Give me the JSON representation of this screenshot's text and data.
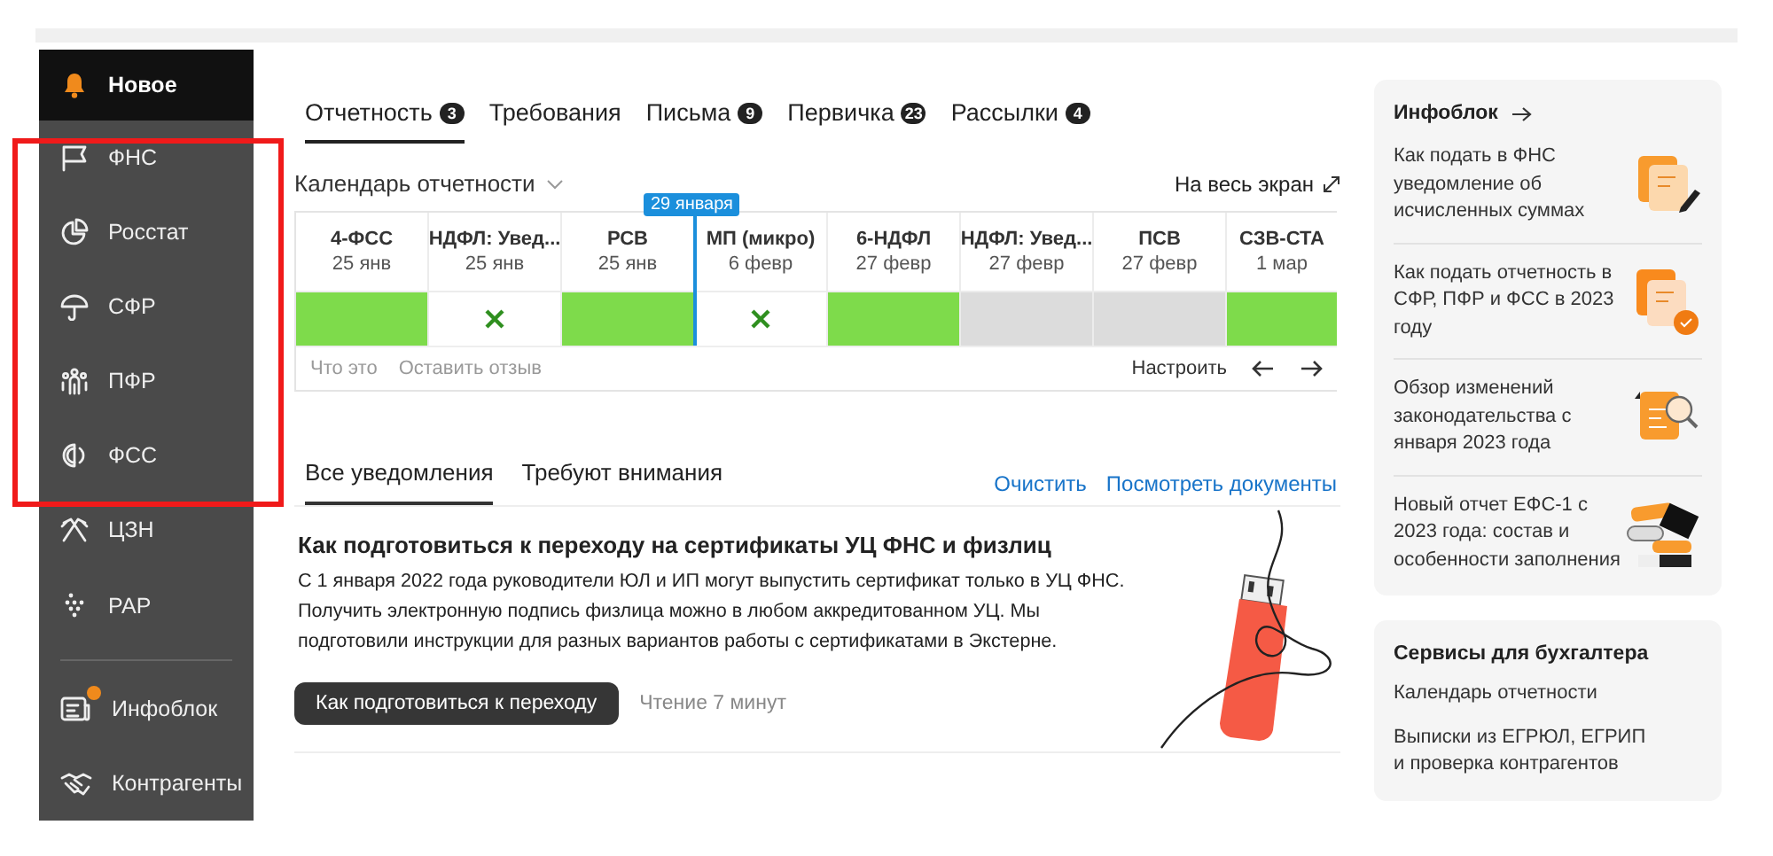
{
  "sidebar": {
    "items": [
      {
        "label": "Новое",
        "selected": true
      },
      {
        "label": "ФНС",
        "selected": false
      },
      {
        "label": "Росстат",
        "selected": false
      },
      {
        "label": "СФР",
        "selected": false
      },
      {
        "label": "ПФР",
        "selected": false
      },
      {
        "label": "ФСС",
        "selected": false
      },
      {
        "label": "ЦЗН",
        "selected": false
      },
      {
        "label": "РАР",
        "selected": false
      }
    ],
    "bottom_items": [
      {
        "label": "Инфоблок",
        "selected": false,
        "badge": true
      },
      {
        "label": "Контрагенты",
        "selected": false,
        "badge": false
      }
    ]
  },
  "tabs": [
    {
      "label": "Отчетность",
      "count": "3",
      "selected": true
    },
    {
      "label": "Требования",
      "selected": false
    },
    {
      "label": "Письма",
      "count": "9",
      "selected": false
    },
    {
      "label": "Первичка",
      "count": "23",
      "selected": false
    },
    {
      "label": "Рассылки",
      "count": "4",
      "selected": false
    }
  ],
  "calendar": {
    "title": "Календарь отчетности",
    "fullscreen": "На весь экран",
    "today": "29 января",
    "columns": [
      {
        "name": "4-ФСС",
        "date": "25 янв",
        "kind": "done",
        "current": false
      },
      {
        "name": "НДФЛ: Увед...",
        "date": "25 янв",
        "kind": "missed",
        "current": false
      },
      {
        "name": "РСВ",
        "date": "25 янв",
        "kind": "done",
        "current": false
      },
      {
        "name": "МП (микро)",
        "date": "6 февр",
        "kind": "missed",
        "current": true
      },
      {
        "name": "6-НДФЛ",
        "date": "27 февр",
        "kind": "done",
        "current": false
      },
      {
        "name": "НДФЛ: Увед...",
        "date": "27 февр",
        "kind": "empty",
        "current": false
      },
      {
        "name": "ПСВ",
        "date": "27 февр",
        "kind": "empty",
        "current": false
      },
      {
        "name": "СЗВ-СТА",
        "date": "1 мар",
        "kind": "done",
        "current": false
      }
    ],
    "footer_links": [
      "Что это",
      "Оставить отзыв"
    ],
    "configure": "Настроить"
  },
  "notices": {
    "tabs": [
      {
        "label": "Все уведомления",
        "selected": true
      },
      {
        "label": "Требуют внимания",
        "selected": false
      }
    ],
    "actions": [
      "Очистить",
      "Посмотреть документы"
    ],
    "article": {
      "title": "Как подготовиться к переходу на сертификаты УЦ ФНС и физлиц",
      "text": "С 1 января 2022 года руководители ЮЛ и ИП могут выпустить сертификат только в УЦ ФНС. Получить электронную подпись физлица можно в любом аккредитованном УЦ. Мы подготовили инструкции для разных вариантов работы с сертификатами в Экстерне.",
      "button": "Как подготовиться к переходу",
      "read_time": "Чтение 7 минут"
    }
  },
  "infoblock": {
    "title": "Инфоблок",
    "items": [
      {
        "text": "Как подать в ФНС уведомление об исчисленных суммах"
      },
      {
        "text": "Как подать отчетность в СФР, ПФР и ФСС в 2023 году"
      },
      {
        "text": "Обзор изменений законодательства с января 2023 года"
      },
      {
        "text": "Новый отчет ЕФС-1 с 2023 года: состав и особенности заполнения"
      }
    ]
  },
  "services": {
    "title": "Сервисы для бухгалтера",
    "items": [
      "Календарь отчетности",
      "Выписки из ЕГРЮЛ, ЕГРИП и проверка контрагентов"
    ]
  }
}
